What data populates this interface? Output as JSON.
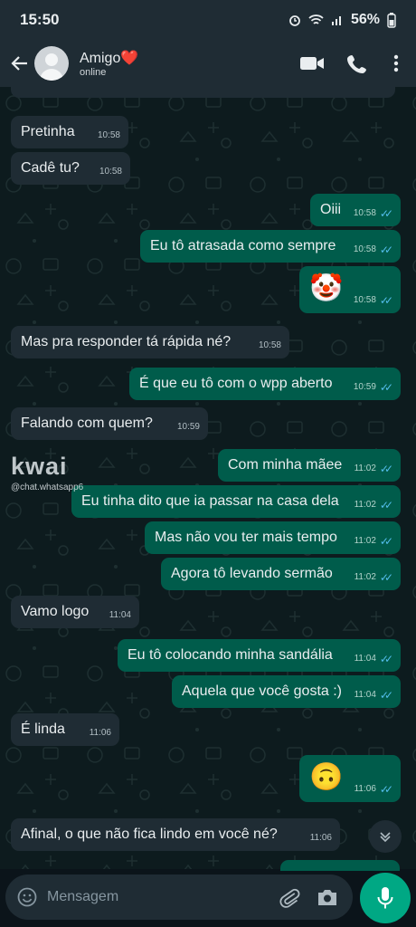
{
  "status_bar": {
    "time": "15:50",
    "battery": "56%"
  },
  "header": {
    "name": "Amigo",
    "heart": "❤️",
    "status": "online"
  },
  "icons": {
    "back": "arrow-left-icon",
    "video": "video-camera-icon",
    "call": "phone-icon",
    "menu": "more-vertical-icon",
    "emoji": "emoji-icon",
    "attach": "paperclip-icon",
    "camera": "camera-icon",
    "mic": "microphone-icon",
    "scroll": "chevron-down-icon"
  },
  "watermark": {
    "logo": "kwai",
    "handle": "@chat.whatsapp6"
  },
  "messages": [
    {
      "dir": "in",
      "text": "Pretinha",
      "time": "10:58"
    },
    {
      "dir": "in",
      "text": "Cadê tu?",
      "time": "10:58"
    },
    {
      "dir": "out",
      "text": "Oiii",
      "time": "10:58"
    },
    {
      "dir": "out",
      "text": "Eu tô atrasada como sempre",
      "time": "10:58"
    },
    {
      "dir": "out",
      "text": "🤡",
      "time": "10:58"
    },
    {
      "dir": "in",
      "text": "Mas pra responder tá rápida né?",
      "time": "10:58"
    },
    {
      "dir": "out",
      "text": "É que eu tô com o wpp aberto",
      "time": "10:59"
    },
    {
      "dir": "in",
      "text": "Falando com quem?",
      "time": "10:59"
    },
    {
      "dir": "out",
      "text": "Com minha mãee",
      "time": "11:02"
    },
    {
      "dir": "out",
      "text": "Eu tinha dito que ia passar na casa dela",
      "time": "11:02"
    },
    {
      "dir": "out",
      "text": "Mas não vou ter mais tempo",
      "time": "11:02"
    },
    {
      "dir": "out",
      "text": "Agora tô levando sermão",
      "time": "11:02"
    },
    {
      "dir": "in",
      "text": "Vamo logo",
      "time": "11:04"
    },
    {
      "dir": "out",
      "text": "Eu tô colocando minha sandália",
      "time": "11:04"
    },
    {
      "dir": "out",
      "text": "Aquela que você gosta :)",
      "time": "11:04"
    },
    {
      "dir": "in",
      "text": "É linda",
      "time": "11:06"
    },
    {
      "dir": "out",
      "text": "🙃",
      "time": "11:06"
    },
    {
      "dir": "in",
      "text": "Afinal, o que não fica lindo em você né?",
      "time": "11:06"
    }
  ],
  "composer": {
    "placeholder": "Mensagem"
  },
  "colors": {
    "header": "#1f2c34",
    "incoming": "#1f2c34",
    "outgoing": "#005c4b",
    "accent": "#00a884",
    "read_tick": "#53bdeb"
  }
}
